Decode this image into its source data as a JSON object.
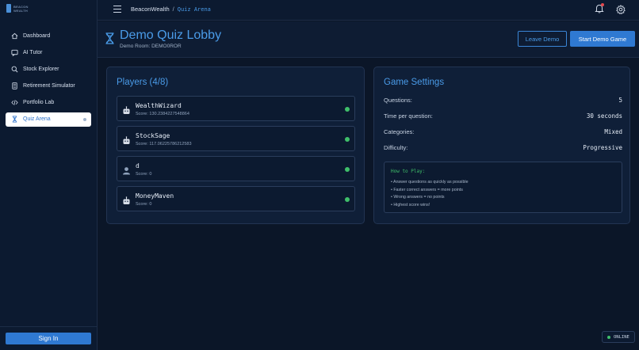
{
  "app": {
    "logo_text_line1": "BEACON",
    "logo_text_line2": "WEALTH"
  },
  "sidebar": {
    "items": [
      {
        "label": "Dashboard",
        "icon": "home-icon"
      },
      {
        "label": "AI Tutor",
        "icon": "chat-icon"
      },
      {
        "label": "Stock Explorer",
        "icon": "search-icon"
      },
      {
        "label": "Retirement Simulator",
        "icon": "calculator-icon"
      },
      {
        "label": "Portfolio Lab",
        "icon": "code-icon"
      },
      {
        "label": "Quiz Arena",
        "icon": "hourglass-icon",
        "active": true
      }
    ],
    "signin_label": "Sign In"
  },
  "topbar": {
    "breadcrumb_root": "BeaconWealth",
    "breadcrumb_sep": "/",
    "breadcrumb_current": "Quiz Arena"
  },
  "header": {
    "title": "Demo Quiz Lobby",
    "subtitle": "Demo Room: DEMO0ROR",
    "leave_label": "Leave Demo",
    "start_label": "Start Demo Game"
  },
  "players": {
    "title": "Players (4/8)",
    "list": [
      {
        "name": "WealthWizard",
        "score": "Score: 130.2384227548864",
        "icon": "robot-icon"
      },
      {
        "name": "StockSage",
        "score": "Score: 117.06225786212583",
        "icon": "robot-icon"
      },
      {
        "name": "d",
        "score": "Score: 0",
        "icon": "user-icon"
      },
      {
        "name": "MoneyMaven",
        "score": "Score: 0",
        "icon": "robot-icon"
      }
    ]
  },
  "settings": {
    "title": "Game Settings",
    "rows": [
      {
        "label": "Questions:",
        "value": "5"
      },
      {
        "label": "Time per question:",
        "value": "30 seconds"
      },
      {
        "label": "Categories:",
        "value": "Mixed"
      },
      {
        "label": "Difficulty:",
        "value": "Progressive"
      }
    ],
    "howto_title": "How to Play:",
    "howto_items": [
      "• Answer questions as quickly as possible",
      "• Faster correct answers = more points",
      "• Wrong answers = no points",
      "• Highest score wins!"
    ]
  },
  "status": {
    "online_label": "ONLINE"
  },
  "colors": {
    "accent": "#4a9be8",
    "primary_button": "#2f79d2",
    "online_green": "#3fbf6a",
    "notification_red": "#e5484d"
  }
}
